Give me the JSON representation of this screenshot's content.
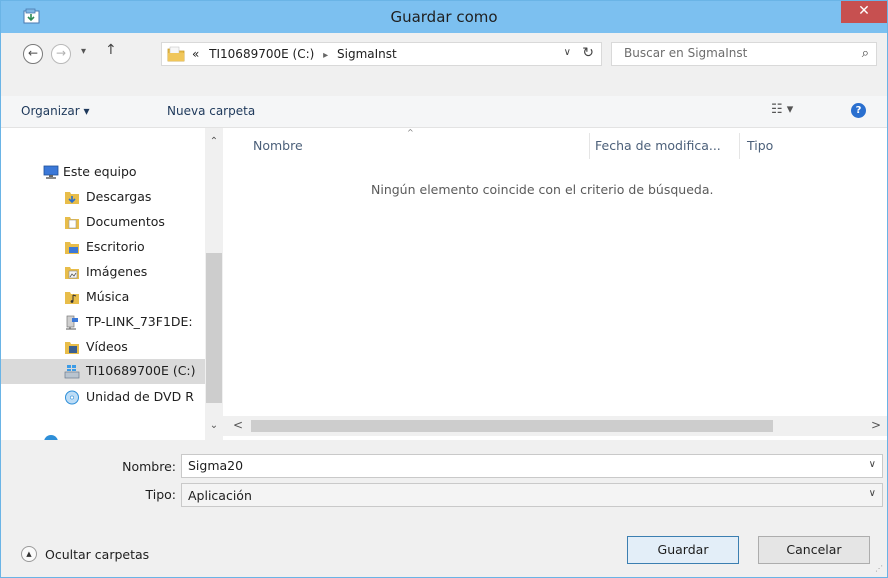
{
  "window": {
    "title": "Guardar como",
    "close_label": "✕",
    "app_icon": "save-dialog-icon"
  },
  "navigation": {
    "back_icon": "←",
    "forward_icon": "→",
    "recent_icon": "▾",
    "up_icon": "↑",
    "breadcrumb_overflow": "«",
    "breadcrumbs": [
      "TI10689700E (C:)",
      "SigmaInst"
    ],
    "breadcrumb_sep": "▸",
    "dropdown_icon": "∨",
    "refresh_icon": "↻",
    "search_placeholder": "Buscar en SigmaInst",
    "search_icon": "⌕"
  },
  "commandbar": {
    "organize_label": "Organizar ▾",
    "new_folder_label": "Nueva carpeta",
    "view_icon": "☷ ▾",
    "help_icon": "?"
  },
  "sidebar": {
    "items": [
      {
        "label": "Este equipo",
        "icon": "computer-icon",
        "color": "#3b78d8"
      },
      {
        "label": "Descargas",
        "icon": "downloads-folder-icon",
        "color": "#e2b13c"
      },
      {
        "label": "Documentos",
        "icon": "documents-folder-icon",
        "color": "#e2b13c"
      },
      {
        "label": "Escritorio",
        "icon": "desktop-folder-icon",
        "color": "#e2b13c"
      },
      {
        "label": "Imágenes",
        "icon": "pictures-folder-icon",
        "color": "#e2b13c"
      },
      {
        "label": "Música",
        "icon": "music-folder-icon",
        "color": "#e2b13c"
      },
      {
        "label": "TP-LINK_73F1DE:",
        "icon": "network-drive-icon",
        "color": "#7a7a7a"
      },
      {
        "label": "Vídeos",
        "icon": "videos-folder-icon",
        "color": "#e2b13c"
      },
      {
        "label": "TI10689700E (C:)",
        "icon": "local-disk-icon",
        "color": "#4a8bd0"
      },
      {
        "label": "Unidad de DVD R",
        "icon": "dvd-drive-icon",
        "color": "#2e8fd8"
      }
    ],
    "scroll_up": "⌃",
    "scroll_down": "⌄"
  },
  "file_list": {
    "columns": [
      "Nombre",
      "Fecha de modifica...",
      "Tipo"
    ],
    "sort_caret": "^",
    "empty_message": "Ningún elemento coincide con el criterio de búsqueda.",
    "scroll_left": "<",
    "scroll_right": ">"
  },
  "form": {
    "name_label": "Nombre:",
    "name_value": "Sigma20",
    "type_label": "Tipo:",
    "type_value": "Aplicación",
    "chevron": "∨"
  },
  "footer": {
    "hide_folders_icon": "▲",
    "hide_folders_label": "Ocultar carpetas",
    "save_label": "Guardar",
    "cancel_label": "Cancelar",
    "grip": "⋰"
  }
}
